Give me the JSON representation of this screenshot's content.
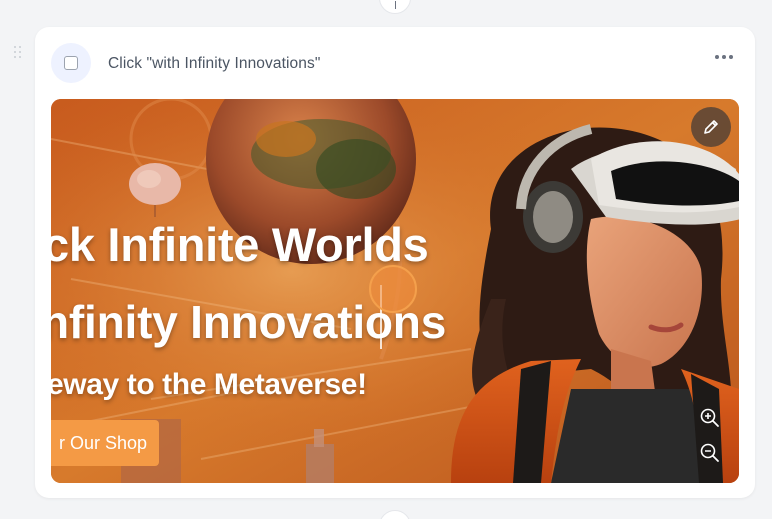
{
  "step": {
    "title": "Click \"with Infinity Innovations\"",
    "icon": "click-target-icon"
  },
  "toolbar": {
    "more_icon": "more-horizontal-icon",
    "edit_icon": "pencil-icon",
    "zoom_in_icon": "zoom-in-icon",
    "zoom_out_icon": "zoom-out-icon"
  },
  "screenshot": {
    "headline_1": "ck Infinite Worlds",
    "headline_2": "nfinity Innovations",
    "headline_3": "eway to the Metaverse!",
    "cta_label": "r Our Shop"
  },
  "colors": {
    "accent_orange": "#f49a45",
    "background_orange": "#c9621a",
    "card_background": "#ffffff",
    "page_background": "#f3f4f6"
  }
}
